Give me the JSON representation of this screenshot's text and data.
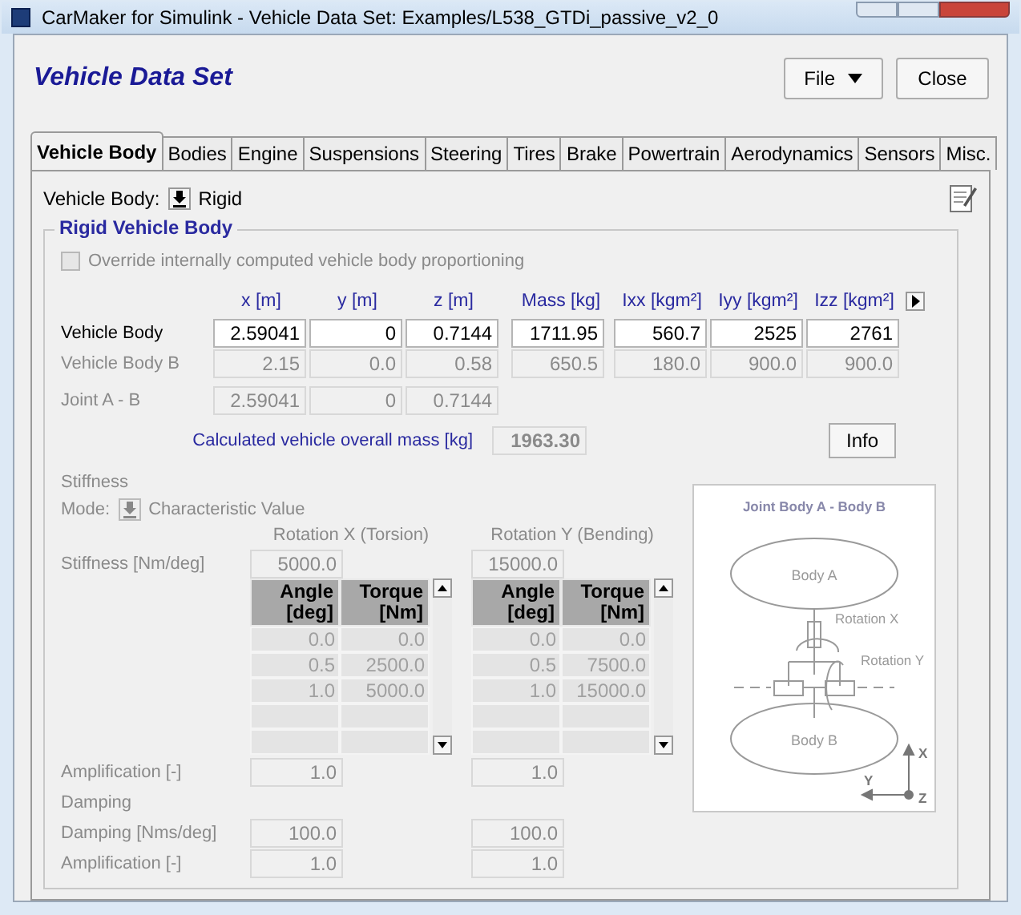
{
  "window": {
    "title": "CarMaker for Simulink - Vehicle Data Set: Examples/L538_GTDi_passive_v2_0"
  },
  "header": {
    "title": "Vehicle Data Set"
  },
  "buttons": [
    {
      "label": "File",
      "kind": "menu"
    },
    {
      "label": "Close",
      "kind": "plain"
    }
  ],
  "tabs": [
    {
      "label": "Vehicle Body",
      "selected": true
    },
    {
      "label": "Bodies",
      "selected": false
    },
    {
      "label": "Engine",
      "selected": false
    },
    {
      "label": "Suspensions",
      "selected": false
    },
    {
      "label": "Steering",
      "selected": false
    },
    {
      "label": "Tires",
      "selected": false
    },
    {
      "label": "Brake",
      "selected": false
    },
    {
      "label": "Powertrain",
      "selected": false
    },
    {
      "label": "Aerodynamics",
      "selected": false
    },
    {
      "label": "Sensors",
      "selected": false
    },
    {
      "label": "Misc.",
      "selected": false
    }
  ],
  "vehicle_body": {
    "label": "Vehicle Body:",
    "value": "Rigid"
  },
  "group": {
    "title": "Rigid Vehicle Body",
    "override": {
      "label": "Override internally computed vehicle body proportioning",
      "checked": false,
      "disabled": true
    },
    "columns": [
      "x [m]",
      "y [m]",
      "z [m]",
      "Mass [kg]",
      "Ixx [kgm²]",
      "Iyy [kgm²]",
      "Izz [kgm²]"
    ],
    "rows": [
      {
        "label": "Vehicle Body",
        "disabled": false,
        "values": [
          "2.59041",
          "0",
          "0.7144",
          "1711.95",
          "560.7",
          "2525",
          "2761"
        ]
      },
      {
        "label": "Vehicle Body B",
        "disabled": true,
        "values": [
          "2.15",
          "0.0",
          "0.58",
          "650.5",
          "180.0",
          "900.0",
          "900.0"
        ]
      },
      {
        "label": "Joint A - B",
        "disabled": true,
        "values": [
          "2.59041",
          "0",
          "0.7144"
        ]
      }
    ],
    "calculated": {
      "label": "Calculated vehicle overall mass [kg]",
      "value": "1963.30"
    },
    "info_button": "Info"
  },
  "stiffness": {
    "title": "Stiffness",
    "mode_label": "Mode:",
    "mode_value": "Characteristic Value",
    "stiffness_label": "Stiffness [Nm/deg]",
    "amplification_label": "Amplification [-]",
    "damping_title": "Damping",
    "damping_label": "Damping [Nms/deg]",
    "damping_amplification_label": "Amplification [-]",
    "rotations": [
      {
        "heading": "Rotation X (Torsion)",
        "stiffness": "5000.0",
        "columns": [
          "Angle [deg]",
          "Torque [Nm]"
        ],
        "rows": [
          [
            "0.0",
            "0.0"
          ],
          [
            "0.5",
            "2500.0"
          ],
          [
            "1.0",
            "5000.0"
          ]
        ],
        "amplification": "1.0",
        "damping": "100.0",
        "damping_amplification": "1.0"
      },
      {
        "heading": "Rotation Y (Bending)",
        "stiffness": "15000.0",
        "columns": [
          "Angle [deg]",
          "Torque [Nm]"
        ],
        "rows": [
          [
            "0.0",
            "0.0"
          ],
          [
            "0.5",
            "7500.0"
          ],
          [
            "1.0",
            "15000.0"
          ]
        ],
        "amplification": "1.0",
        "damping": "100.0",
        "damping_amplification": "1.0"
      }
    ]
  },
  "diagram": {
    "title": "Joint Body A - Body B",
    "body_a": "Body A",
    "body_b": "Body B",
    "rotation_x": "Rotation X",
    "rotation_y": "Rotation Y",
    "axis_x": "X",
    "axis_y": "Y",
    "axis_z": "Z"
  }
}
